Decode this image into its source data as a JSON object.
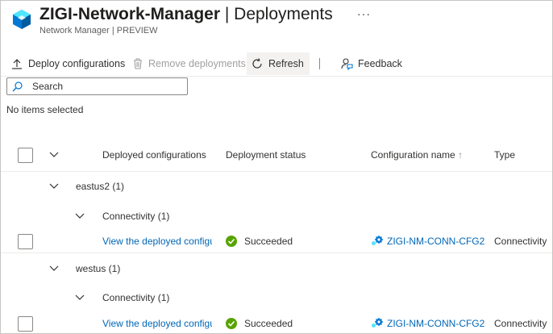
{
  "header": {
    "title_bold": "ZIGI-Network-Manager",
    "title_sep": " | ",
    "title_rest": "Deployments",
    "subtitle": "Network Manager | PREVIEW",
    "more_label": "···"
  },
  "toolbar": {
    "deploy_label": "Deploy configurations",
    "remove_label": "Remove deployments",
    "refresh_label": "Refresh",
    "feedback_label": "Feedback"
  },
  "search": {
    "placeholder": "Search"
  },
  "selection_info": "No items selected",
  "table": {
    "columns": {
      "deployed": "Deployed configurations",
      "status": "Deployment status",
      "config_name": "Configuration name",
      "sort_arrow": "↑",
      "type": "Type"
    },
    "groups": [
      {
        "region": "eastus2 (1)",
        "subgroup": "Connectivity (1)",
        "row": {
          "link": "View the deployed configurations",
          "status": "Succeeded",
          "config_name": "ZIGI-NM-CONN-CFG2",
          "type": "Connectivity"
        }
      },
      {
        "region": "westus (1)",
        "subgroup": "Connectivity (1)",
        "row": {
          "link": "View the deployed configurations",
          "status": "Succeeded",
          "config_name": "ZIGI-NM-CONN-CFG2",
          "type": "Connectivity"
        }
      }
    ]
  },
  "colors": {
    "link": "#0067b8",
    "success": "#57a300",
    "resource_icon": "#0078d4",
    "config_icon": "#0078d4"
  }
}
